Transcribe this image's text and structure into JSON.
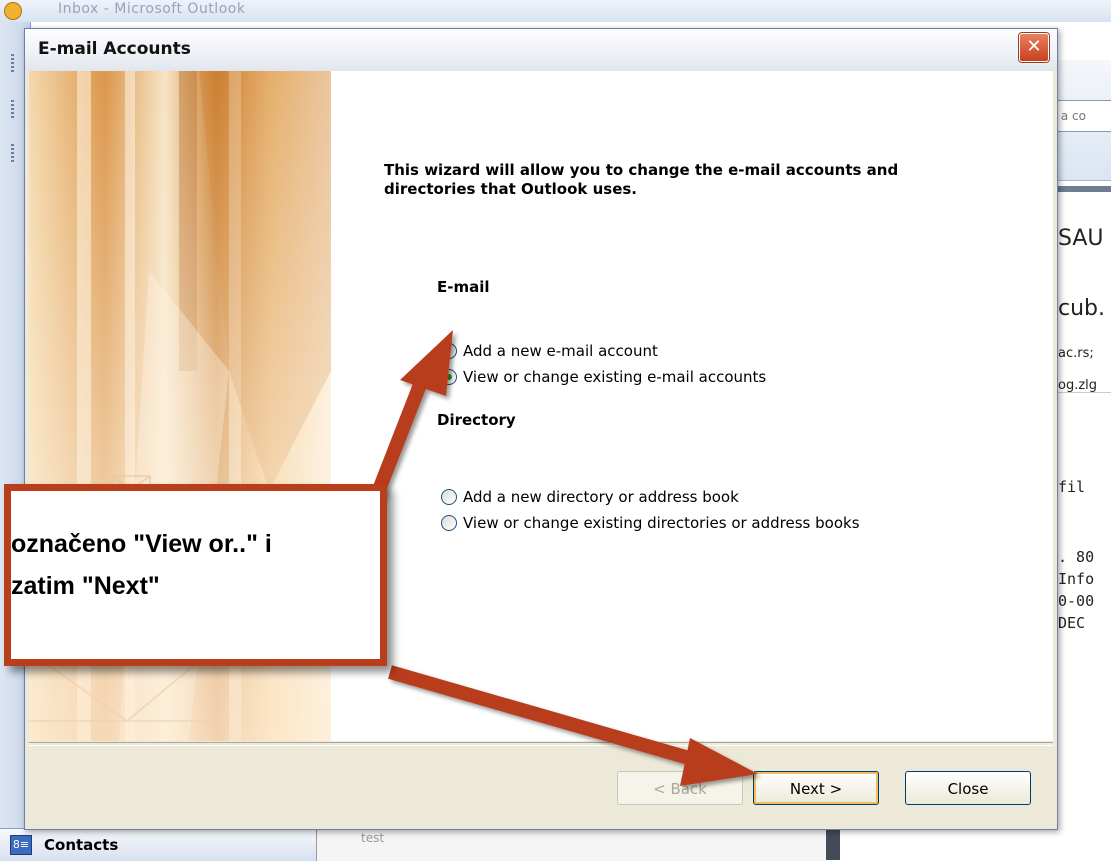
{
  "background": {
    "app_title": "Inbox - Microsoft Outlook",
    "search_hint": "pe a co",
    "preview_lines": [
      "SAU",
      "cub.",
      "ac.rs;",
      "og.zlg",
      "fil",
      ". 80",
      "Info",
      "0-00",
      "DEC"
    ],
    "nav_contacts": "Contacts",
    "list_item_text": "test"
  },
  "dialog": {
    "title": "E-mail Accounts",
    "intro": "This wizard will allow you to change the e-mail accounts and directories that Outlook uses.",
    "email_section": "E-mail",
    "email_options": [
      {
        "label": "Add a new e-mail account",
        "selected": false
      },
      {
        "label": "View or change existing e-mail accounts",
        "selected": true
      }
    ],
    "directory_section": "Directory",
    "directory_options": [
      {
        "label": "Add a new directory or address book",
        "selected": false
      },
      {
        "label": "View or change existing directories or address books",
        "selected": false
      }
    ],
    "buttons": {
      "back": "< Back",
      "next": "Next >",
      "close": "Close"
    }
  },
  "annotation": {
    "callout_text": "označeno \"View or..\" i\nzatim \"Next\"",
    "color": "#b83e1c"
  }
}
